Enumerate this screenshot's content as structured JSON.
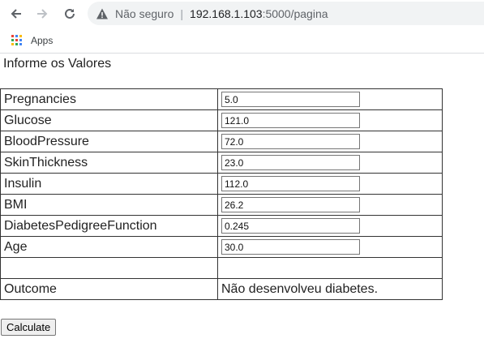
{
  "browser": {
    "security_label": "Não seguro",
    "separator": "|",
    "url_host": "192.168.1.103",
    "url_path": ":5000/pagina",
    "bookmark_apps": "Apps",
    "apps_colors": [
      "#ea4335",
      "#4285f4",
      "#fbbc05",
      "#34a853",
      "#ea4335",
      "#4285f4",
      "#fbbc05",
      "#34a853",
      "#4285f4"
    ]
  },
  "page": {
    "heading": "Informe os Valores",
    "fields": [
      {
        "label": "Pregnancies",
        "value": "5.0"
      },
      {
        "label": "Glucose",
        "value": "121.0"
      },
      {
        "label": "BloodPressure",
        "value": "72.0"
      },
      {
        "label": "SkinThickness",
        "value": "23.0"
      },
      {
        "label": "Insulin",
        "value": "112.0"
      },
      {
        "label": "BMI",
        "value": "26.2"
      },
      {
        "label": "DiabetesPedigreeFunction",
        "value": "0.245"
      },
      {
        "label": "Age",
        "value": "30.0"
      }
    ],
    "outcome_label": "Outcome",
    "outcome_value": "Não desenvolveu diabetes.",
    "calculate_label": "Calculate"
  }
}
